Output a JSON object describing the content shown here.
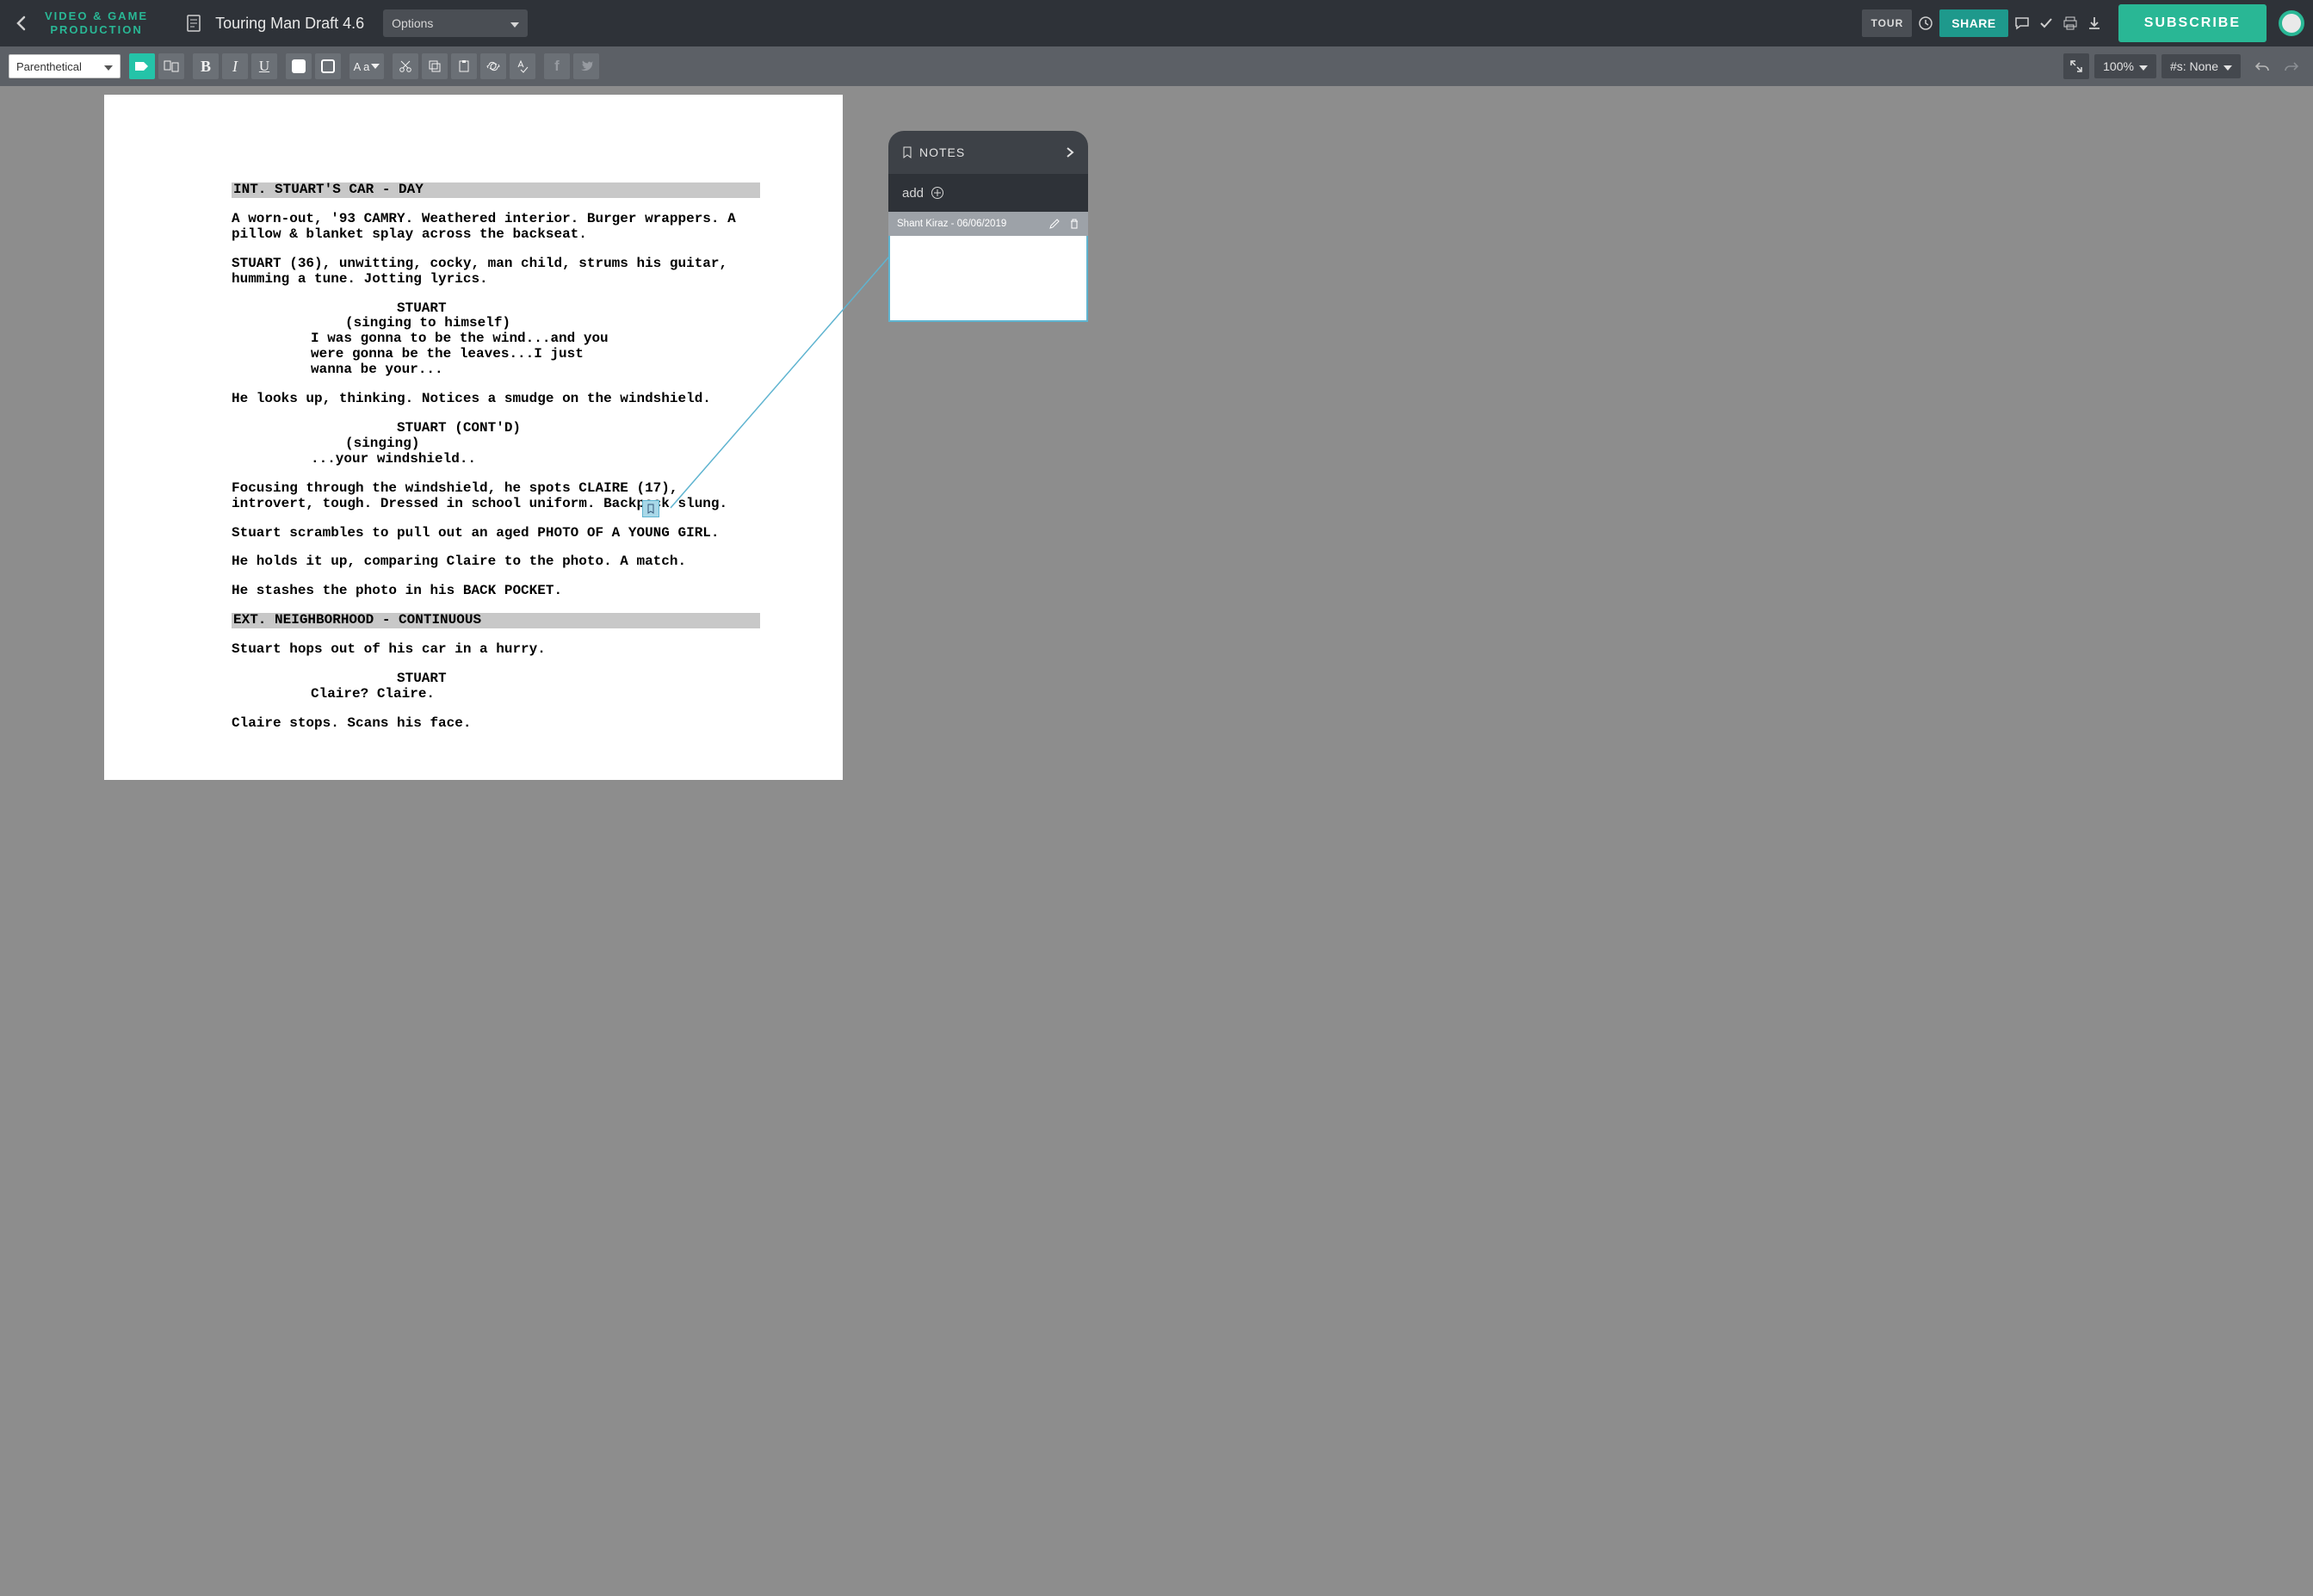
{
  "header": {
    "brand_line1": "VIDEO & GAME",
    "brand_line2": "PRODUCTION",
    "doc_title": "Touring Man Draft 4.6",
    "options_label": "Options",
    "tour_label": "TOUR",
    "share_label": "SHARE",
    "subscribe_label": "SUBSCRIBE"
  },
  "toolbar": {
    "element_type": "Parenthetical",
    "case_label": "A a",
    "zoom": "100%",
    "scene_numbers": "#s: None"
  },
  "notes": {
    "panel_title": "NOTES",
    "add_label": "add",
    "card_author": "Shant Kiraz",
    "card_date": "06/06/2019"
  },
  "script": {
    "scene1_slug": "INT. STUART'S CAR - DAY",
    "action1": "A worn-out, '93 CAMRY. Weathered interior. Burger wrappers. A pillow & blanket splay across the backseat.",
    "action2": "STUART (36), unwitting, cocky, man child, strums his guitar, humming a tune. Jotting lyrics.",
    "char1": "STUART",
    "paren1": "(singing to himself)",
    "dialog1": "I was gonna to be the wind...and you were gonna be the leaves...I just wanna be your...",
    "action3": "He looks up, thinking. Notices a smudge on the windshield.",
    "char2": "STUART (CONT'D)",
    "paren2": "(singing)",
    "dialog2": "...your windshield..",
    "action4": "Focusing through the windshield, he spots CLAIRE (17), introvert, tough. Dressed in school uniform. Backpack slung.",
    "action5": "Stuart scrambles to pull out an aged PHOTO OF A YOUNG GIRL.",
    "action6": "He holds it up, comparing Claire to the photo. A match.",
    "action7": "He stashes the photo in his BACK POCKET.",
    "scene2_slug": "EXT. NEIGHBORHOOD - CONTINUOUS",
    "action8": "Stuart hops out of his car in a hurry.",
    "char3": "STUART",
    "dialog3": "Claire? Claire.",
    "action9": "Claire stops. Scans his face."
  }
}
